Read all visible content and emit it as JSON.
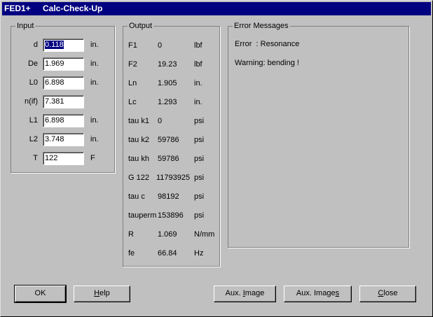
{
  "window": {
    "app": "FED1+",
    "title": "Calc-Check-Up"
  },
  "input": {
    "legend": "Input",
    "rows": [
      {
        "label": "d",
        "value": "0.118",
        "unit": "in."
      },
      {
        "label": "De",
        "value": "1.969",
        "unit": "in."
      },
      {
        "label": "L0",
        "value": "6.898",
        "unit": "in."
      },
      {
        "label": "n(if)",
        "value": "7.381",
        "unit": ""
      },
      {
        "label": "L1",
        "value": "6.898",
        "unit": "in."
      },
      {
        "label": "L2",
        "value": "3.748",
        "unit": "in."
      },
      {
        "label": "T",
        "value": "122",
        "unit": "F"
      }
    ]
  },
  "output": {
    "legend": "Output",
    "rows": [
      {
        "label": "F1",
        "value": "0",
        "unit": "lbf"
      },
      {
        "label": "F2",
        "value": "19.23",
        "unit": "lbf"
      },
      {
        "label": "Ln",
        "value": "1.905",
        "unit": "in."
      },
      {
        "label": "Lc",
        "value": "1.293",
        "unit": "in."
      },
      {
        "label": "tau k1",
        "value": "0",
        "unit": "psi"
      },
      {
        "label": "tau k2",
        "value": "59786",
        "unit": "psi"
      },
      {
        "label": "tau kh",
        "value": "59786",
        "unit": "psi"
      },
      {
        "label": "G 122",
        "value": "11793925",
        "unit": "psi"
      },
      {
        "label": "tau c",
        "value": "98192",
        "unit": "psi"
      },
      {
        "label": "tauperm",
        "value": "153896",
        "unit": "psi"
      },
      {
        "label": "R",
        "value": "1.069",
        "unit": "N/mm"
      },
      {
        "label": "fe",
        "value": "66.84",
        "unit": "Hz"
      }
    ]
  },
  "errors": {
    "legend": "Error Messages",
    "messages": [
      "Error  : Resonance",
      "Warning: bending !"
    ]
  },
  "buttons": {
    "ok": "OK",
    "help": {
      "mnemonic": "H",
      "rest": "elp"
    },
    "aux_image": {
      "pre": "Aux. ",
      "mnemonic": "I",
      "rest": "mage"
    },
    "aux_images": {
      "pre": "Aux. Image",
      "mnemonic": "s",
      "rest": ""
    },
    "close": {
      "mnemonic": "C",
      "rest": "lose"
    }
  }
}
